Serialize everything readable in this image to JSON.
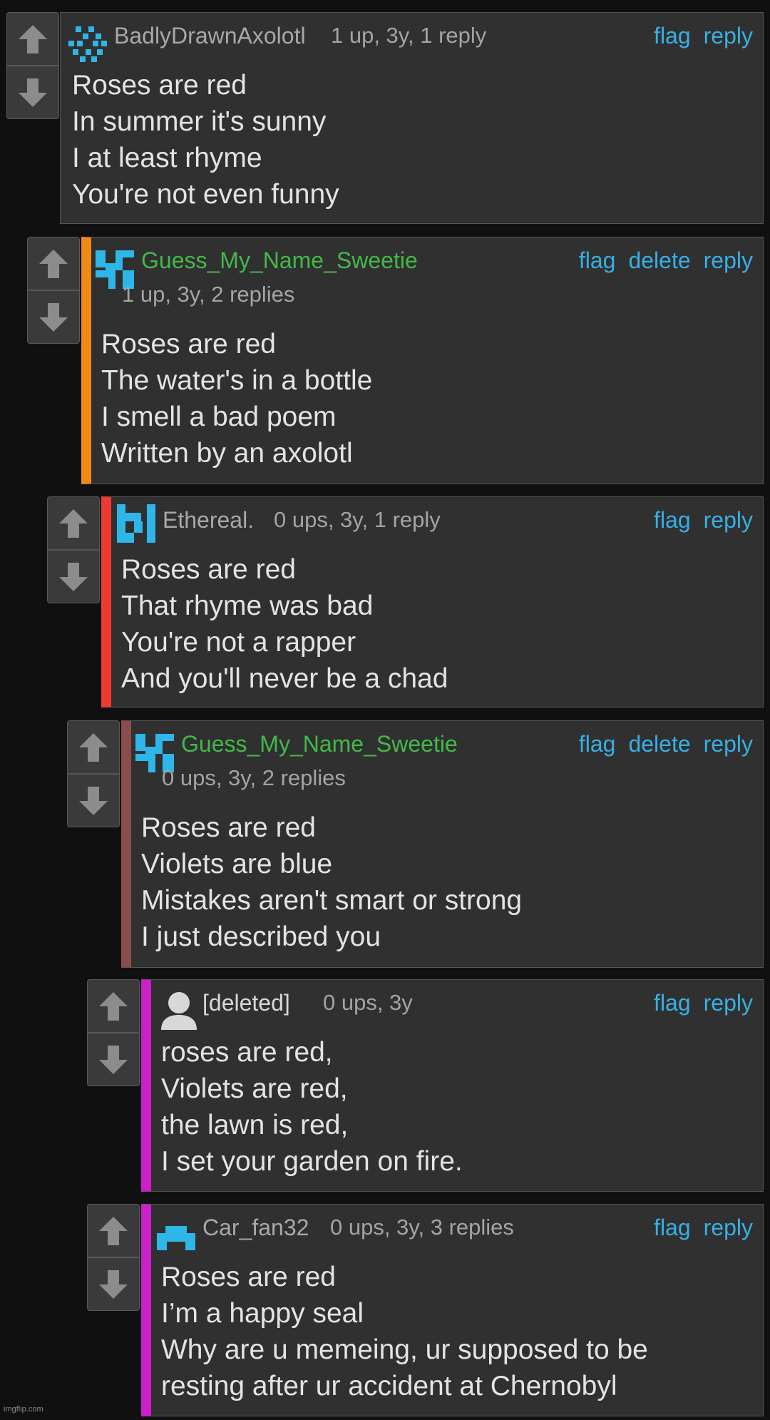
{
  "colors": {
    "background": "#101010",
    "card": "#303030",
    "link": "#37b0e6",
    "op_username": "#43b94a",
    "thread_border_1": "#f08a14",
    "thread_border_2": "#ee3b32",
    "thread_border_3": "#8a4d4b",
    "thread_border_4": "#cc1ecb"
  },
  "comments": [
    {
      "username": "BadlyDrawnAxolotl",
      "meta": "1 up, 3y, 1 reply",
      "actions": [
        "flag",
        "reply"
      ],
      "avatar": "pixel-avatar-icon",
      "lines": [
        "Roses are red",
        "In summer it's sunny",
        "I at least rhyme",
        "You're not even funny"
      ]
    },
    {
      "username": "Guess_My_Name_Sweetie",
      "meta": "1 up, 3y, 2 replies",
      "actions": [
        "flag",
        "delete",
        "reply"
      ],
      "avatar": "pixel-avatar-icon",
      "lines": [
        "Roses are red",
        "The water's in a bottle",
        "I smell a bad poem",
        "Written by an axolotl"
      ]
    },
    {
      "username": "Ethereal.",
      "meta": "0 ups, 3y, 1 reply",
      "actions": [
        "flag",
        "reply"
      ],
      "avatar": "pixel-avatar-icon",
      "lines": [
        "Roses are red",
        "That rhyme was bad",
        "You're not a rapper",
        "And you'll never be a chad"
      ]
    },
    {
      "username": "Guess_My_Name_Sweetie",
      "meta": "0 ups, 3y, 2 replies",
      "actions": [
        "flag",
        "delete",
        "reply"
      ],
      "avatar": "pixel-avatar-icon",
      "lines": [
        "Roses are red",
        "Violets are blue",
        "Mistakes aren't smart or strong",
        "I just described you"
      ]
    },
    {
      "username": "[deleted]",
      "meta": "0 ups, 3y",
      "actions": [
        "flag",
        "reply"
      ],
      "avatar": "default-user-icon",
      "lines": [
        "roses are red,",
        "Violets are red,",
        "the lawn is red,",
        "I set your garden on fire."
      ]
    },
    {
      "username": "Car_fan32",
      "meta": "0 ups, 3y, 3 replies",
      "actions": [
        "flag",
        "reply"
      ],
      "avatar": "pixel-avatar-icon",
      "lines": [
        "Roses are red",
        "I’m a happy seal",
        "Why are u memeing, ur supposed to be",
        "resting after ur accident at Chernobyl"
      ]
    }
  ],
  "watermark": "imgflip.com"
}
